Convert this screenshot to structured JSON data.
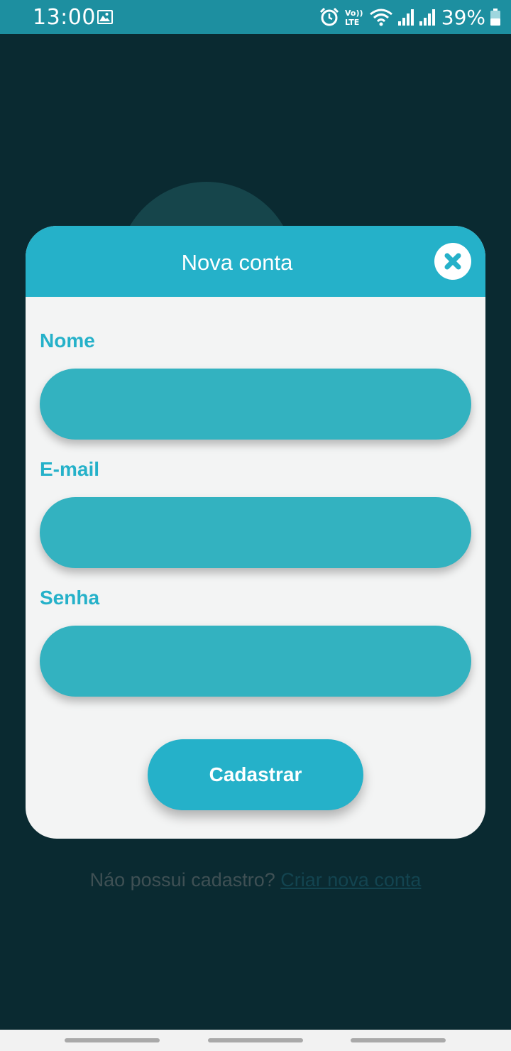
{
  "status_bar": {
    "time": "13:00",
    "volte_top": "Vo))",
    "volte_bottom": "LTE",
    "battery_percent": "39%"
  },
  "background": {
    "signup_prompt": "Náo possui cadastro?",
    "signup_link": "Criar nova conta"
  },
  "modal": {
    "title": "Nova conta",
    "fields": [
      {
        "label": "Nome",
        "value": ""
      },
      {
        "label": "E-mail",
        "value": ""
      },
      {
        "label": "Senha",
        "value": ""
      }
    ],
    "submit_label": "Cadastrar"
  },
  "icons": {
    "status": [
      "gallery-icon",
      "alarm-icon",
      "volte-icon",
      "wifi-icon",
      "signal-icon",
      "battery-icon"
    ],
    "close": "close-icon"
  },
  "colors": {
    "status_bar": "#1d8fa0",
    "background": "#0a2a31",
    "accent": "#25b1c9",
    "input_fill": "#33b2c0",
    "modal_body": "#f3f4f4"
  }
}
